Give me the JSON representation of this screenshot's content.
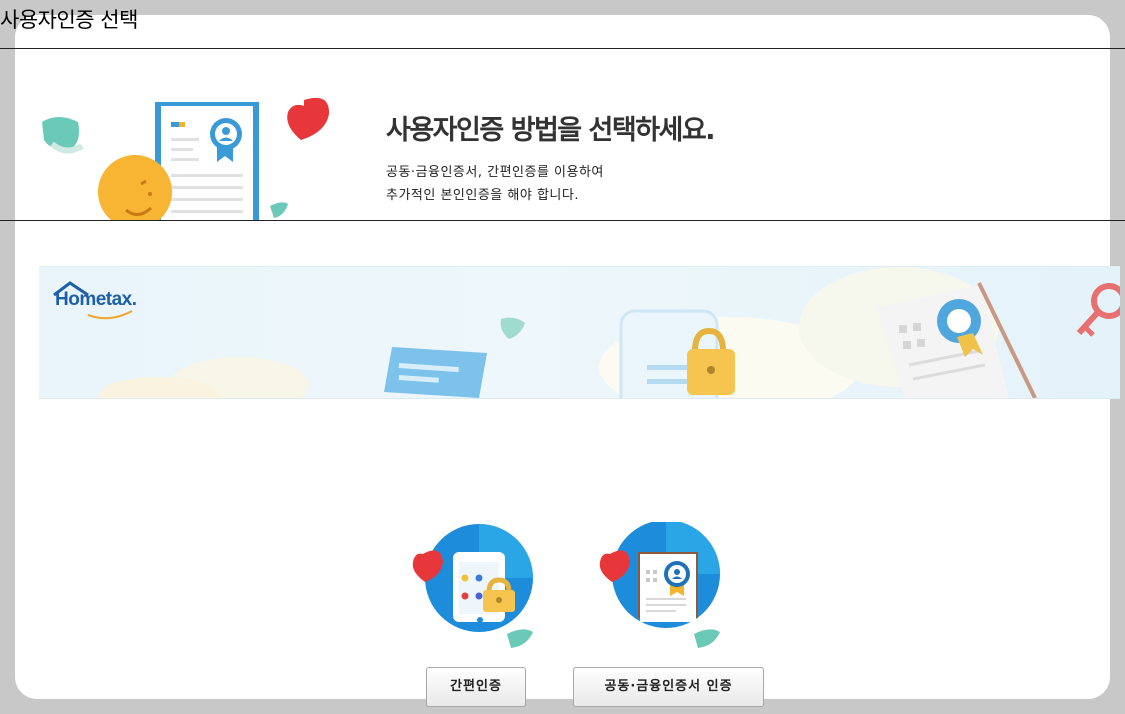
{
  "window": {
    "title": "사용자인증 선택"
  },
  "hero": {
    "title": "사용자인증 방법을 선택하세요.",
    "desc_line1": "공동·금융인증서, 간편인증를 이용하여",
    "desc_line2": "추가적인 본인인증을 해야 합니다."
  },
  "banner": {
    "logo_text": "Hometax."
  },
  "methods": {
    "simple": {
      "label": "간편인증",
      "icon": "phone-lock-icon"
    },
    "certificate": {
      "label": "공동·금융인증서 인증",
      "icon": "certificate-icon"
    }
  },
  "colors": {
    "accent_blue": "#1a8fd8",
    "heart_red": "#e8373a",
    "background": "#c8c8c8"
  }
}
